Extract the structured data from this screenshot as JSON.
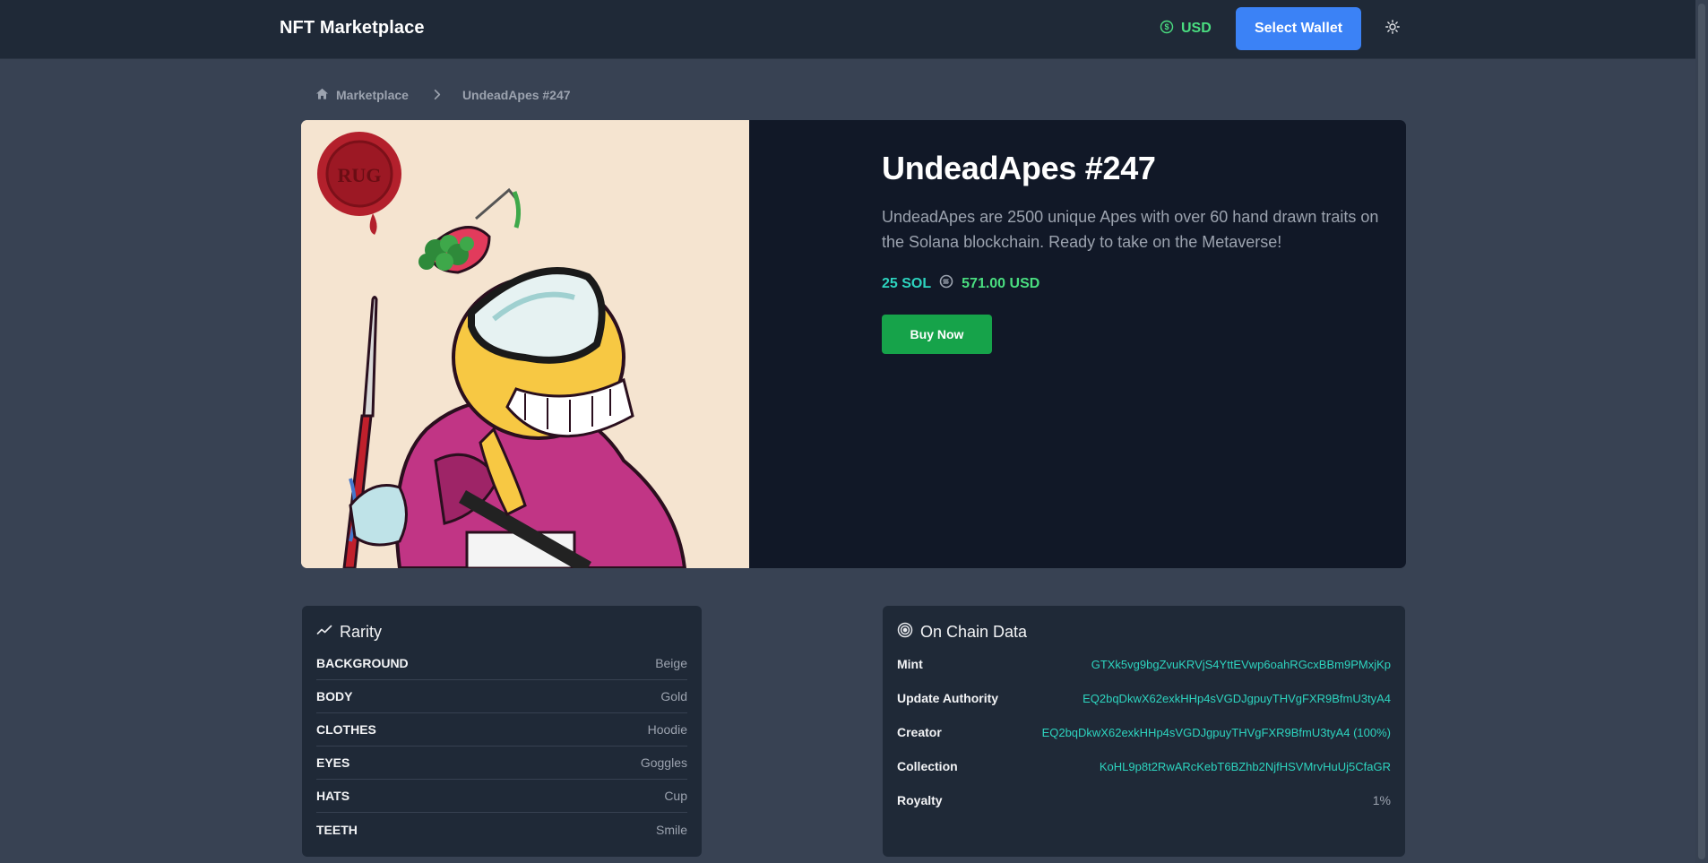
{
  "nav": {
    "brand": "NFT Marketplace",
    "currency": "USD",
    "wallet_button": "Select Wallet"
  },
  "breadcrumb": {
    "home": "Marketplace",
    "current": "UndeadApes #247"
  },
  "nft": {
    "badge_text": "RUG",
    "title": "UndeadApes #247",
    "description": "UndeadApes are 2500 unique Apes with over 60 hand drawn traits on the Solana blockchain. Ready to take on the Metaverse!",
    "price_sol": "25 SOL",
    "price_usd": "571.00 USD",
    "buy_button": "Buy Now"
  },
  "rarity": {
    "title": "Rarity",
    "traits": [
      {
        "name": "BACKGROUND",
        "value": "Beige"
      },
      {
        "name": "BODY",
        "value": "Gold"
      },
      {
        "name": "CLOTHES",
        "value": "Hoodie"
      },
      {
        "name": "EYES",
        "value": "Goggles"
      },
      {
        "name": "HATS",
        "value": "Cup"
      },
      {
        "name": "TEETH",
        "value": "Smile"
      }
    ]
  },
  "onchain": {
    "title": "On Chain Data",
    "rows": [
      {
        "label": "Mint",
        "value": "GTXk5vg9bgZvuKRVjS4YttEVwp6oahRGcxBBm9PMxjKp"
      },
      {
        "label": "Update Authority",
        "value": "EQ2bqDkwX62exkHHp4sVGDJgpuyTHVgFXR9BfmU3tyA4"
      },
      {
        "label": "Creator",
        "value": "EQ2bqDkwX62exkHHp4sVGDJgpuyTHVgFXR9BfmU3tyA4 (100%)"
      },
      {
        "label": "Collection",
        "value": "KoHL9p8t2RwARcKebT6BZhb2NjfHSVMrvHuUj5CfaGR"
      },
      {
        "label": "Royalty",
        "value": "1%"
      }
    ]
  },
  "colors": {
    "page_bg": "#384253",
    "navbar_bg": "#1f2937",
    "card_bg": "#111827",
    "panel_bg": "#1f2937",
    "accent_blue": "#3b82f6",
    "accent_green": "#16a34a",
    "price_green": "#4ade80",
    "teal": "#2dd4bf"
  },
  "icons": {
    "currency": "dollar-circle-icon",
    "theme": "sun-icon",
    "home": "home-icon",
    "separator": "chevron-right-icon",
    "sol": "solana-circle-icon",
    "rarity": "trending-chart-icon",
    "onchain": "target-icon"
  }
}
